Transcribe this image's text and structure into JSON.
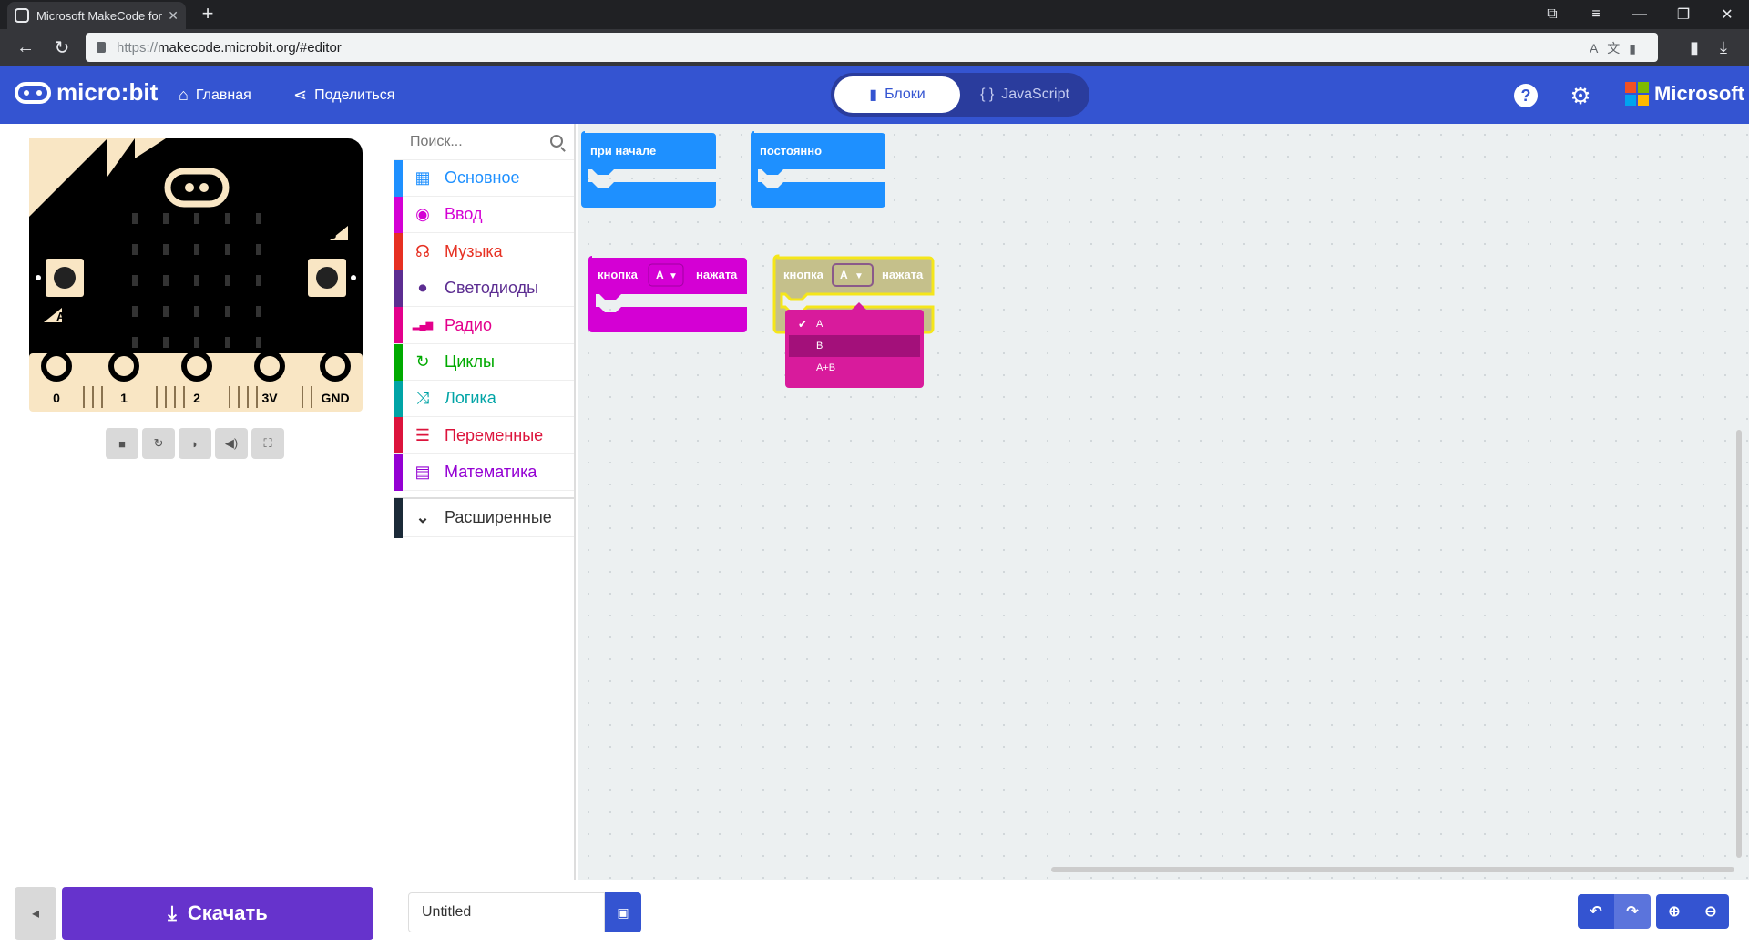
{
  "browser": {
    "tab_title": "Microsoft MakeCode for micro:bit",
    "tab_close": "✕",
    "new_tab": "+",
    "url_protocol": "https://",
    "url_rest": "makecode.microbit.org/#editor"
  },
  "header": {
    "brand": "micro:bit",
    "home_label": "Главная",
    "share_label": "Поделиться",
    "blocks_label": "Блоки",
    "js_label": "JavaScript",
    "help_label": "?",
    "microsoft_label": "Microsoft"
  },
  "simulator": {
    "pins": [
      "0",
      "1",
      "2",
      "3V",
      "GND"
    ],
    "button_a": "A",
    "button_b": "B"
  },
  "toolbox": {
    "search_placeholder": "Поиск...",
    "categories": [
      {
        "label": "Основное",
        "color": "#1e90ff",
        "icon": "grid-icon"
      },
      {
        "label": "Ввод",
        "color": "#d400d4",
        "icon": "target-icon"
      },
      {
        "label": "Музыка",
        "color": "#e63022",
        "icon": "headphones-icon"
      },
      {
        "label": "Светодиоды",
        "color": "#5c2d91",
        "icon": "toggle-icon"
      },
      {
        "label": "Радио",
        "color": "#e3008c",
        "icon": "signal-icon"
      },
      {
        "label": "Циклы",
        "color": "#00aa00",
        "icon": "refresh-icon"
      },
      {
        "label": "Логика",
        "color": "#00a4a6",
        "icon": "shuffle-icon"
      },
      {
        "label": "Переменные",
        "color": "#dc143c",
        "icon": "list-icon"
      },
      {
        "label": "Математика",
        "color": "#9400d3",
        "icon": "calculator-icon"
      }
    ],
    "advanced_label": "Расширенные"
  },
  "workspace": {
    "on_start": "при  начале",
    "forever": "постоянно",
    "button_block_1": {
      "prefix": "кнопка",
      "value": "A",
      "suffix": "нажата"
    },
    "button_block_2": {
      "prefix": "кнопка",
      "value": "A",
      "suffix": "нажата"
    },
    "dropdown_options": [
      "A",
      "B",
      "A+B"
    ],
    "dropdown_selected": "A"
  },
  "footer": {
    "download_label": "Скачать",
    "project_name": "Untitled"
  }
}
